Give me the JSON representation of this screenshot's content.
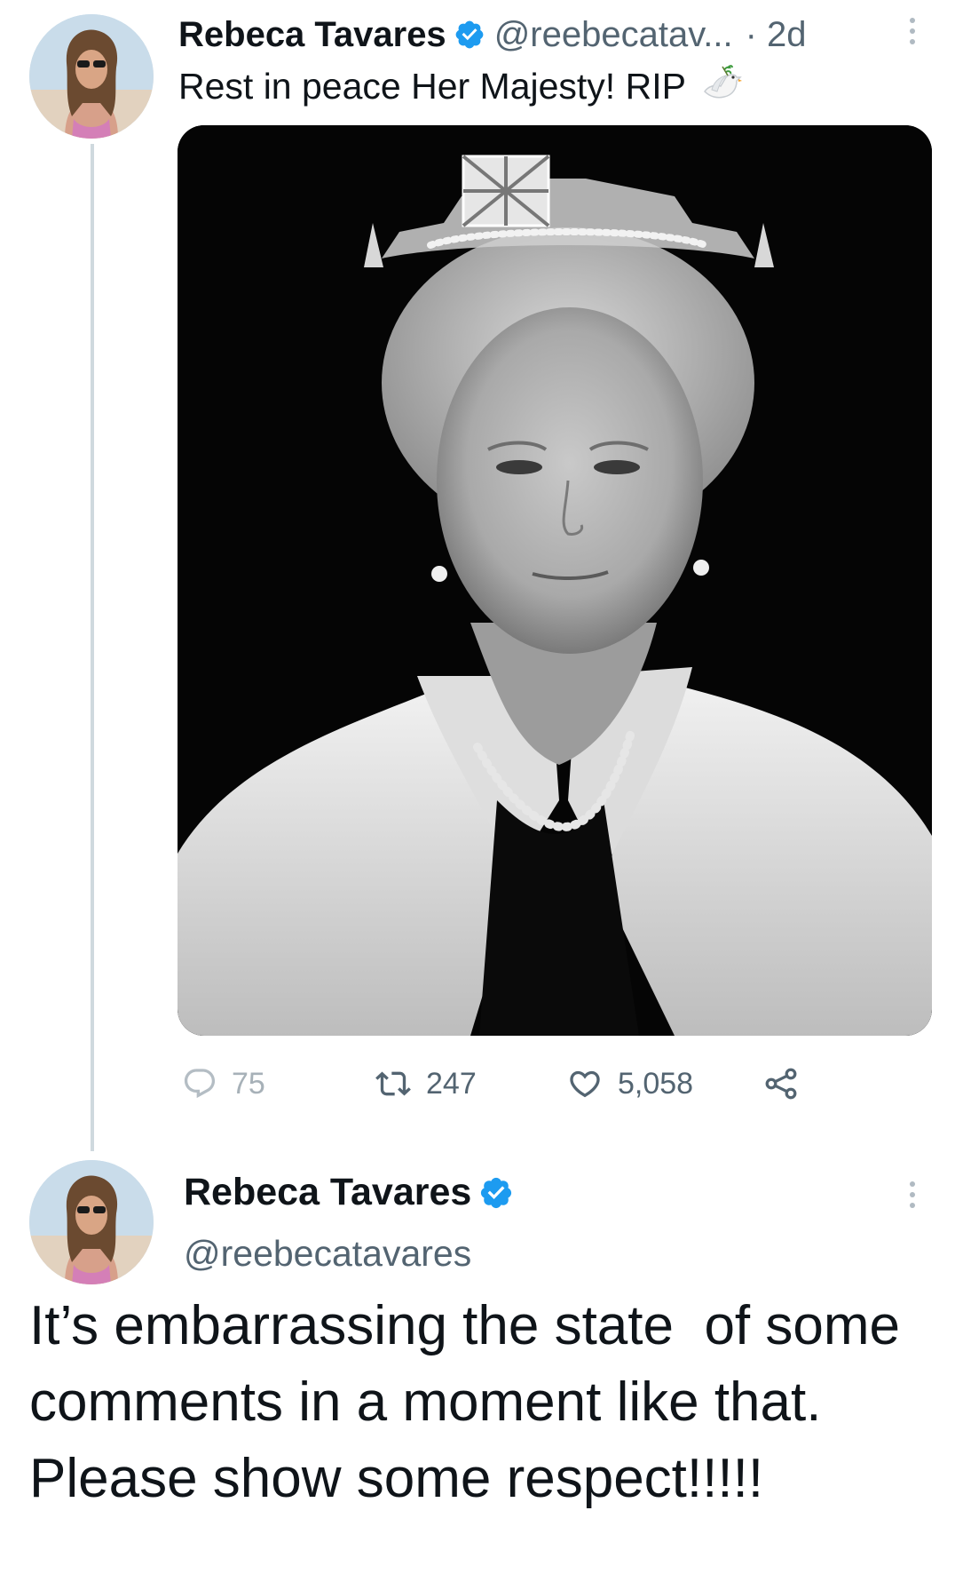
{
  "tweet1": {
    "display_name": "Rebeca Tavares",
    "handle": "@reebecatav...",
    "time": "· 2d",
    "text": "Rest in peace Her Majesty! RIP",
    "stats": {
      "replies": "75",
      "retweets": "247",
      "likes": "5,058"
    }
  },
  "tweet2": {
    "display_name": "Rebeca Tavares",
    "handle": "@reebecatavares",
    "text": "It’s embarrassing the state  of some comments in a moment like that. Please show some respect!!!!!"
  },
  "colors": {
    "verified": "#1d9bf0",
    "muted": "#536471",
    "thread_line": "#cfd9de"
  },
  "icons": [
    "verified-badge-icon",
    "more-icon",
    "dove-emoji-icon",
    "reply-icon",
    "retweet-icon",
    "like-icon",
    "share-icon"
  ]
}
